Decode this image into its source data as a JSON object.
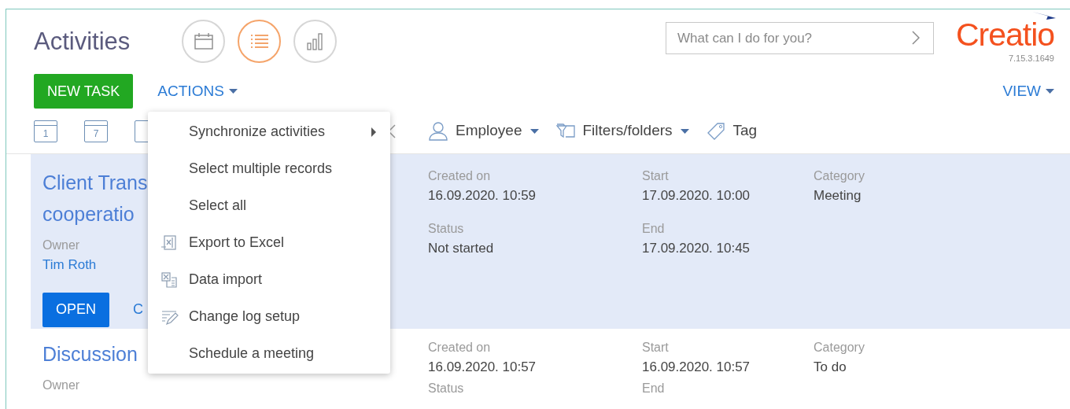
{
  "header": {
    "title": "Activities",
    "views": [
      {
        "selected": false
      },
      {
        "selected": true
      },
      {
        "selected": false
      }
    ],
    "search": {
      "placeholder": "What can I do for you?"
    },
    "logo": "Creatio",
    "version": "7.15.3.1649"
  },
  "actions": {
    "new_task": "NEW TASK",
    "actions": "ACTIONS",
    "view": "VIEW"
  },
  "toolbar": {
    "calendar_days": [
      "1",
      "7"
    ],
    "filters": [
      {
        "label": "Employee",
        "dropdown": true
      },
      {
        "label": "Filters/folders",
        "dropdown": true
      },
      {
        "label": "Tag",
        "dropdown": false
      }
    ]
  },
  "rows": [
    {
      "selected": true,
      "title_lines": [
        "Client Trans",
        "cooperatio"
      ],
      "owner_label": "Owner",
      "owner": "Tim Roth",
      "open": "OPEN",
      "second_button": "C",
      "fields": [
        [
          {
            "label": "Created on",
            "value": "16.09.2020. 10:59"
          },
          {
            "label": "Status",
            "value": "Not started"
          }
        ],
        [
          {
            "label": "Start",
            "value": "17.09.2020. 10:00"
          },
          {
            "label": "End",
            "value": "17.09.2020. 10:45"
          }
        ],
        [
          {
            "label": "Category",
            "value": "Meeting"
          }
        ]
      ]
    },
    {
      "selected": false,
      "title_lines": [
        "Discussion"
      ],
      "owner_label": "Owner",
      "fields": [
        [
          {
            "label": "Created on",
            "value": "16.09.2020. 10:57"
          },
          {
            "label": "Status"
          }
        ],
        [
          {
            "label": "Start",
            "value": "16.09.2020. 10:57"
          },
          {
            "label": "End"
          }
        ],
        [
          {
            "label": "Category",
            "value": "To do"
          }
        ]
      ]
    }
  ],
  "menu": [
    {
      "label": "Synchronize activities",
      "kind": "submenu"
    },
    {
      "label": "Select multiple records",
      "kind": "plain"
    },
    {
      "label": "Select all",
      "kind": "plain"
    },
    {
      "label": "Export to Excel",
      "kind": "export"
    },
    {
      "label": "Data import",
      "kind": "import"
    },
    {
      "label": "Change log setup",
      "kind": "changelog"
    },
    {
      "label": "Schedule a meeting",
      "kind": "plain"
    }
  ]
}
